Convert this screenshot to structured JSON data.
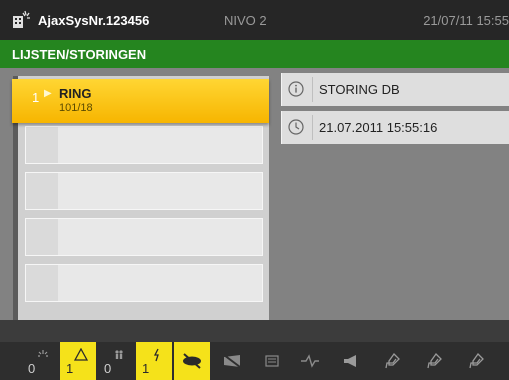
{
  "header": {
    "system_name": "AjaxSysNr.123456",
    "level": "NIVO 2",
    "datetime": "21/07/11 15:55"
  },
  "title_bar": {
    "title": "LIJSTEN/STORINGEN"
  },
  "list": {
    "active_item": {
      "number": "1",
      "label": "RING",
      "sub": "101/18"
    },
    "empty_rows": 4
  },
  "detail": {
    "info_text": "STORING DB",
    "time_text": "21.07.2011 15:55:16"
  },
  "footer": {
    "buttons": [
      {
        "name": "fire-alarm",
        "count": "0",
        "active": false
      },
      {
        "name": "warning",
        "count": "1",
        "active": true
      },
      {
        "name": "persons",
        "count": "0",
        "active": false
      },
      {
        "name": "fault",
        "count": "1",
        "active": true
      },
      {
        "name": "disabled",
        "count": "",
        "active": true
      }
    ],
    "colors": {
      "active": "#f5e21a",
      "active_text": "#2a2a2a",
      "inactive_text": "#cfcfcf"
    }
  },
  "colors": {
    "header_bg": "#262626",
    "title_bar_bg": "#25851f",
    "active_row": "#f7c000",
    "panel_bg": "#828282"
  }
}
